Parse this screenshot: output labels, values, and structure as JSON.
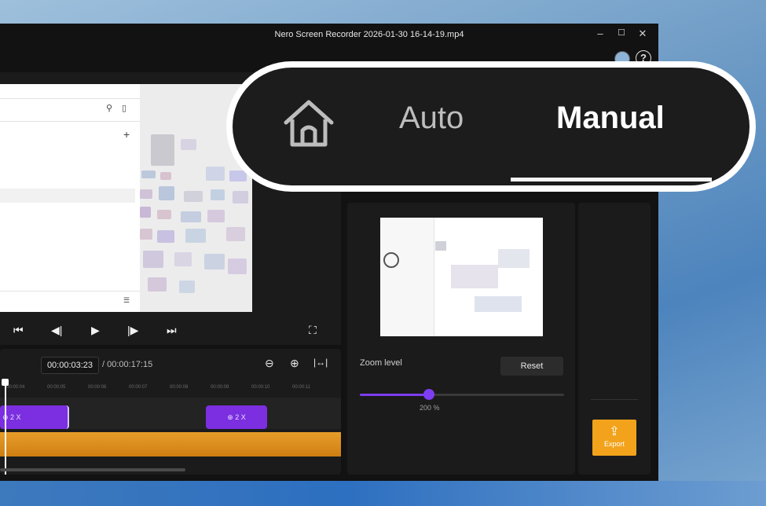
{
  "window": {
    "title": "Nero Screen Recorder 2026-01-30 16-14-19.mp4",
    "minimize_icon": "minimize-icon",
    "maximize_icon": "maximize-icon",
    "close_icon": "close-icon",
    "help_label": "?"
  },
  "callout": {
    "home_icon": "home-icon",
    "tab_auto": "Auto",
    "tab_manual": "Manual",
    "active_tab": "Manual"
  },
  "preview": {
    "search_icon": "search-icon",
    "panel_icon": "panel-icon",
    "add_label": "+"
  },
  "playback": {
    "skip_start_icon": "skip-start-icon",
    "step_back_icon": "step-back-icon",
    "play_icon": "play-icon",
    "step_forward_icon": "step-forward-icon",
    "skip_end_icon": "skip-end-icon",
    "fullscreen_icon": "fullscreen-icon"
  },
  "timeline": {
    "current_time": "00:00:03:23",
    "duration": "/ 00:00:17:15",
    "ruler_labels": [
      "00:00:04",
      "00:00:05",
      "00:00:06",
      "00:00:07",
      "00:00:08",
      "00:00:09",
      "00:00:10",
      "00:00:11"
    ],
    "clips": [
      {
        "label": "2 X"
      },
      {
        "label": "2 X"
      }
    ]
  },
  "zoom_panel": {
    "label": "Zoom level",
    "reset_label": "Reset",
    "value_text": "200 %",
    "slider_fraction": 0.34
  },
  "export": {
    "label": "Export",
    "icon": "upload-icon"
  },
  "colors": {
    "accent_purple": "#7b2fe0",
    "audio_orange": "#e79d2a",
    "export_orange": "#f2a31b"
  }
}
